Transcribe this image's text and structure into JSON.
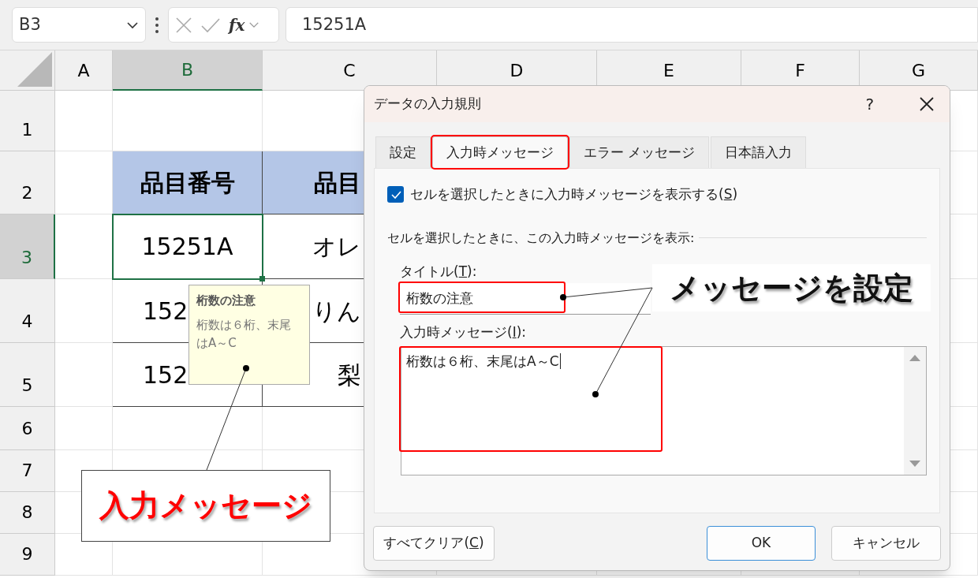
{
  "formula_bar": {
    "name_box": "B3",
    "function_label": "fx",
    "formula": "15251A"
  },
  "sheet": {
    "columns": [
      {
        "label": "A",
        "selected": false
      },
      {
        "label": "B",
        "selected": true
      },
      {
        "label": "C",
        "selected": false
      },
      {
        "label": "D",
        "selected": false
      },
      {
        "label": "E",
        "selected": false
      },
      {
        "label": "F",
        "selected": false
      },
      {
        "label": "G",
        "selected": false
      }
    ],
    "rows": [
      {
        "label": "1",
        "selected": false,
        "kind": "empty"
      },
      {
        "label": "2",
        "selected": false,
        "kind": "table-header",
        "cells": [
          "品目番号",
          "品目"
        ]
      },
      {
        "label": "3",
        "selected": true,
        "kind": "table-data",
        "cells": [
          "15251A",
          "オレ"
        ]
      },
      {
        "label": "4",
        "selected": false,
        "kind": "table-data",
        "cells": [
          "152",
          "りん"
        ]
      },
      {
        "label": "5",
        "selected": false,
        "kind": "table-data",
        "cells": [
          "152",
          "梨"
        ]
      },
      {
        "label": "6",
        "selected": false,
        "kind": "empty"
      },
      {
        "label": "7",
        "selected": false,
        "kind": "empty"
      },
      {
        "label": "8",
        "selected": false,
        "kind": "empty"
      },
      {
        "label": "9",
        "selected": false,
        "kind": "empty"
      }
    ]
  },
  "input_tip": {
    "title": "桁数の注意",
    "body": "桁数は６桁、末尾はA～C"
  },
  "dialog": {
    "title": "データの入力規則",
    "help": "?",
    "tabs": [
      {
        "label": "設定",
        "selected": false,
        "highlighted": false
      },
      {
        "label": "入力時メッセージ",
        "selected": true,
        "highlighted": true
      },
      {
        "label": "エラー メッセージ",
        "selected": false,
        "highlighted": false
      },
      {
        "label": "日本語入力",
        "selected": false,
        "highlighted": false
      }
    ],
    "show_checkbox": {
      "before": "セルを選択したときに入力時メッセージを表示する(",
      "key": "S",
      "after": ")",
      "checked": true
    },
    "group_label": "セルを選択したときに、この入力時メッセージを表示:",
    "title_field": {
      "before": "タイトル(",
      "key": "T",
      "after": "):",
      "value": "桁数の注意",
      "highlighted": true
    },
    "message_field": {
      "before": "入力時メッセージ(",
      "key": "I",
      "after": "):",
      "value": "桁数は６桁、末尾はA～C",
      "highlighted": true
    },
    "buttons": [
      {
        "kind": "clear",
        "before": "すべてクリア(",
        "key": "C",
        "after": ")"
      },
      {
        "kind": "ok",
        "before": "OK"
      },
      {
        "kind": "cancel",
        "before": "キャンセル"
      }
    ]
  },
  "callouts": [
    {
      "kind": "tip",
      "text": "入力メッセージ"
    },
    {
      "kind": "setting",
      "text": "メッセージを設定"
    }
  ]
}
